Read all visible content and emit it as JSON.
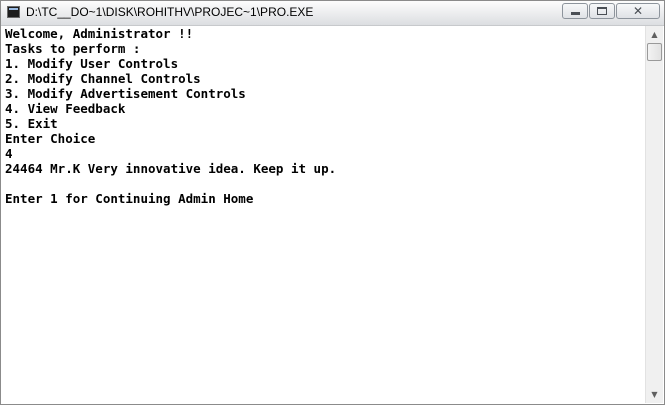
{
  "window": {
    "title": "D:\\TC__DO~1\\DISK\\ROHITHV\\PROJEC~1\\PRO.EXE",
    "minimize_icon": "minimize-icon",
    "maximize_icon": "maximize-icon",
    "close_icon": "close-icon",
    "close_glyph": "✕"
  },
  "console": {
    "lines": [
      "Welcome, Administrator !!",
      "Tasks to perform :",
      "1. Modify User Controls",
      "2. Modify Channel Controls",
      "3. Modify Advertisement Controls",
      "4. View Feedback",
      "5. Exit",
      "Enter Choice",
      "4",
      "24464 Mr.K Very innovative idea. Keep it up.",
      "",
      "Enter 1 for Continuing Admin Home"
    ]
  },
  "scrollbar": {
    "up_arrow": "▲",
    "down_arrow": "▼"
  },
  "colors": {
    "console_background": "#ffffff",
    "console_text": "#000000",
    "titlebar": "#e9eaec"
  }
}
